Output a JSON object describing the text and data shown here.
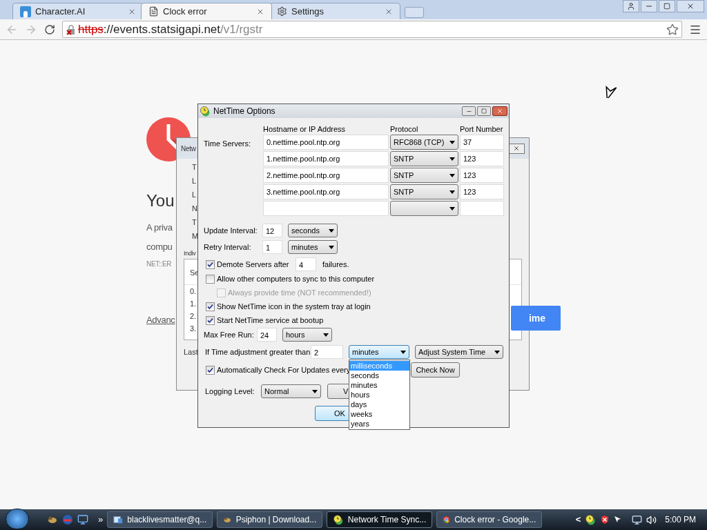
{
  "browser": {
    "tabs": [
      {
        "title": "Character.AI",
        "kind": "site",
        "selected": false
      },
      {
        "title": "Clock error",
        "kind": "page",
        "selected": true
      },
      {
        "title": "Settings",
        "kind": "settings",
        "selected": false
      }
    ],
    "address": {
      "scheme": "https",
      "host": "://events.statsigapi.net",
      "path": "/v1/rgstr"
    }
  },
  "page": {
    "heading": "You",
    "lines": [
      "A priva",
      "compu"
    ],
    "error_code": "NET::ER",
    "link": "Advanc",
    "button": "ime"
  },
  "back_window": {
    "title": "Netw",
    "labels": [
      "T",
      "L",
      "L",
      "N",
      "T",
      "M"
    ],
    "list_caption": "Indiv",
    "list_header": "Se",
    "list_rows": [
      "0.",
      "1.",
      "2.",
      "3."
    ],
    "footer": "Last"
  },
  "dialog": {
    "title": "NetTime Options",
    "columns": [
      "Hostname or IP Address",
      "Protocol",
      "Port Number"
    ],
    "servers_label": "Time Servers:",
    "servers": [
      {
        "host": "0.nettime.pool.ntp.org",
        "protocol": "RFC868 (TCP)",
        "port": "37"
      },
      {
        "host": "1.nettime.pool.ntp.org",
        "protocol": "SNTP",
        "port": "123"
      },
      {
        "host": "2.nettime.pool.ntp.org",
        "protocol": "SNTP",
        "port": "123"
      },
      {
        "host": "3.nettime.pool.ntp.org",
        "protocol": "SNTP",
        "port": "123"
      }
    ],
    "update": {
      "label": "Update Interval:",
      "value": "12",
      "unit": "seconds"
    },
    "retry": {
      "label": "Retry Interval:",
      "value": "1",
      "unit": "minutes"
    },
    "demote": {
      "label": "Demote Servers after",
      "value": "4",
      "suffix": "failures.",
      "checked": true
    },
    "options": [
      {
        "label": "Allow other computers to sync to this computer",
        "checked": false,
        "disabled": false,
        "children": [
          {
            "label": "Always provide time (NOT recommended!)",
            "checked": false,
            "disabled": true
          }
        ]
      },
      {
        "label": "Show NetTime icon in the system tray at login",
        "checked": true,
        "disabled": false
      },
      {
        "label": "Start NetTime service at bootup",
        "checked": true,
        "disabled": false
      }
    ],
    "max_free_run": {
      "label": "Max Free Run:",
      "value": "24",
      "unit": "hours"
    },
    "adjust": {
      "label": "If Time adjustment greater than",
      "value": "2",
      "unit": "minutes",
      "expanded": true,
      "unit_options": [
        {
          "label": "milliseconds",
          "selected": true
        },
        {
          "label": "seconds",
          "selected": false
        },
        {
          "label": "minutes",
          "selected": false
        },
        {
          "label": "hours",
          "selected": false
        },
        {
          "label": "days",
          "selected": false
        },
        {
          "label": "weeks",
          "selected": false
        },
        {
          "label": "years",
          "selected": false
        }
      ],
      "action": "Adjust System Time"
    },
    "updates": {
      "label": "Automatically Check For Updates every",
      "checked": true,
      "button": "Check Now"
    },
    "logging": {
      "label": "Logging Level:",
      "value": "Normal",
      "button": "V"
    },
    "ok": "OK"
  },
  "taskbar": {
    "overflow": "»",
    "items": [
      {
        "label": "blacklivesmatter@q...",
        "kind": "mail",
        "selected": false
      },
      {
        "label": "Psiphon | Download...",
        "kind": "psiphon",
        "selected": false
      },
      {
        "label": "Network Time Sync...",
        "kind": "nettime",
        "selected": true
      },
      {
        "label": "Clock error - Google...",
        "kind": "chrome",
        "selected": false
      }
    ],
    "tray_arrow": "<",
    "clock": "5:00 PM"
  }
}
